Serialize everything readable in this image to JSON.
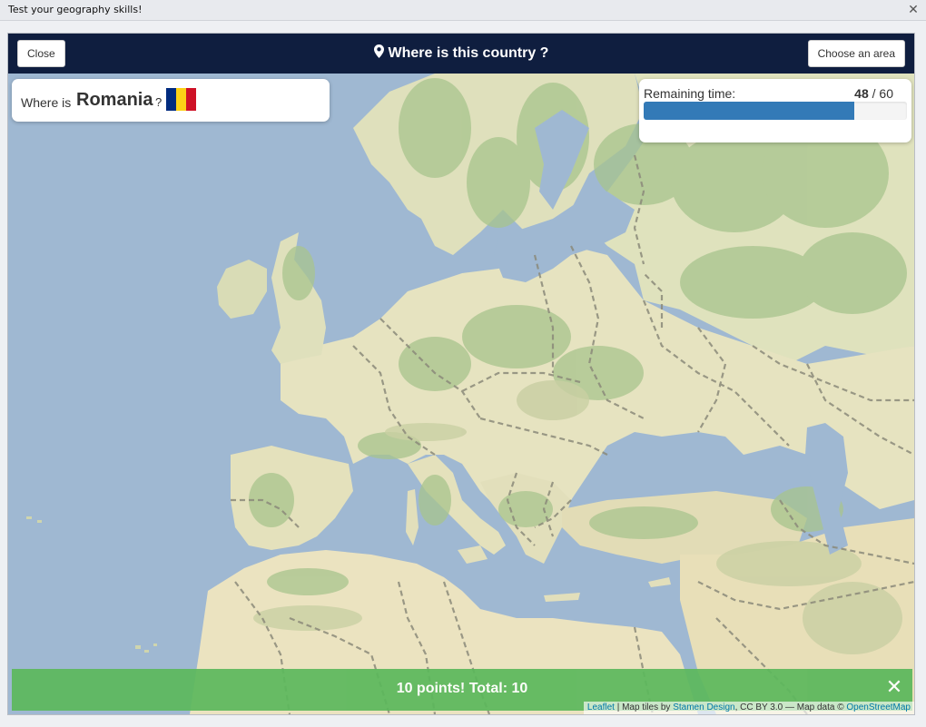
{
  "window": {
    "title": "Test your geography skills!",
    "close_glyph": "✕"
  },
  "topbar": {
    "close_label": "Close",
    "title": "Where is this country ?",
    "title_icon": "map-marker-icon",
    "area_label": "Choose an area",
    "background": "#0f1e3f"
  },
  "question": {
    "prefix": "Where is",
    "country": "Romania",
    "suffix": "?",
    "flag_colors": [
      "#002b7f",
      "#fcd116",
      "#ce1126"
    ]
  },
  "timer": {
    "label": "Remaining time:",
    "remaining": "48",
    "separator": " / ",
    "total": "60",
    "progress_fraction": 0.8,
    "bar_color": "#337ab7"
  },
  "score": {
    "text": "10 points!  Total: 10",
    "close_glyph": "✕",
    "color": "#5cb85c"
  },
  "attribution": {
    "leaflet": "Leaflet",
    "sep1": " | Map tiles by ",
    "stamen": "Stamen Design",
    "sep2": ", CC BY 3.0 — Map data © ",
    "osm": "OpenStreetMap"
  },
  "map": {
    "water_color": "#9fb8d2",
    "land_color": "#e6e3c0",
    "forest_color": "#a9c48e"
  }
}
